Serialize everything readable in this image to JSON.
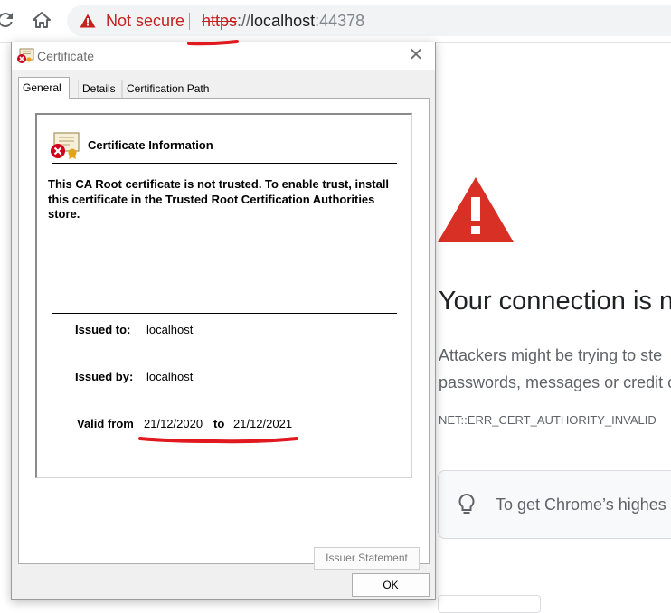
{
  "browser": {
    "security_label": "Not secure",
    "url_scheme": "https",
    "url_sep": "://",
    "url_host": "localhost",
    "url_port": ":44378",
    "icons": [
      "reload-icon",
      "home-icon",
      "warning-triangle-icon"
    ]
  },
  "interstitial": {
    "heading": "Your connection is n",
    "description_line1": "Attackers might be trying to ste",
    "description_line2": "passwords, messages or credit c",
    "error_code": "NET::ERR_CERT_AUTHORITY_INVALID",
    "tip_text": "To get Chrome’s highes",
    "colors": {
      "warning_red": "#d93025"
    }
  },
  "dialog": {
    "title": "Certificate",
    "tabs": [
      {
        "label": "General",
        "active": true
      },
      {
        "label": "Details",
        "active": false
      },
      {
        "label": "Certification Path",
        "active": false
      }
    ],
    "info_heading": "Certificate Information",
    "warning_message": "This CA Root certificate is not trusted. To enable trust, install this certificate in the Trusted Root Certification Authorities store.",
    "issued_to_label": "Issued to:",
    "issued_to_value": "localhost",
    "issued_by_label": "Issued by:",
    "issued_by_value": "localhost",
    "valid_from_label": "Valid from",
    "valid_from_value": "21/12/2020",
    "valid_to_label": "to",
    "valid_to_value": "21/12/2021",
    "issuer_statement_label": "Issuer Statement",
    "ok_label": "OK"
  },
  "annotations": {
    "color": "#e0191f"
  }
}
